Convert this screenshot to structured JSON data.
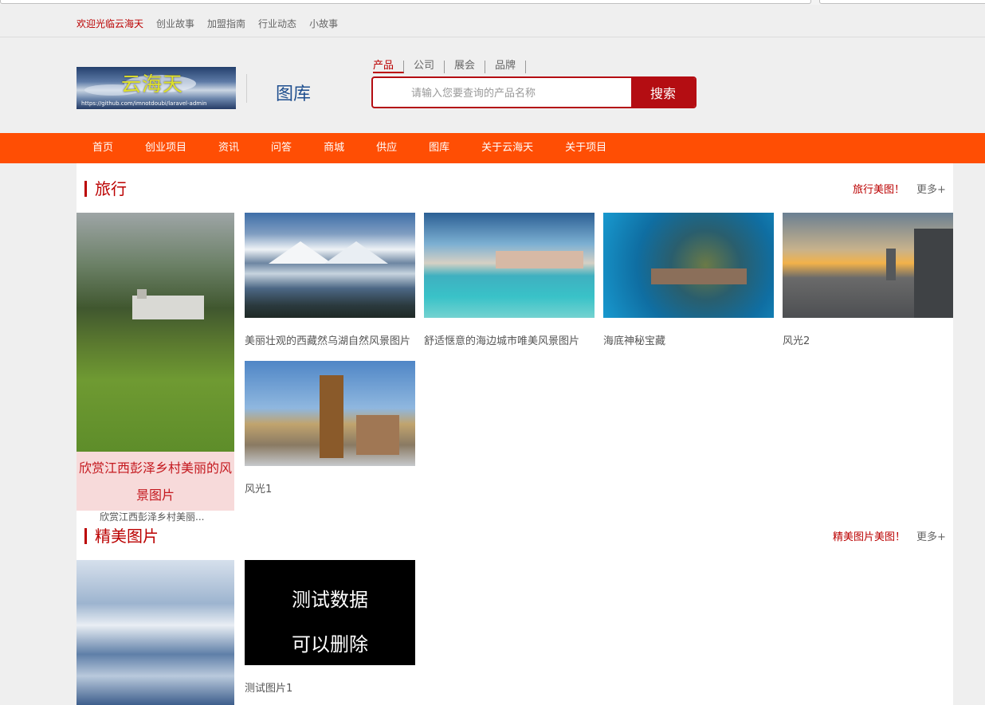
{
  "topbar": {
    "welcome": "欢迎光临云海天",
    "links": [
      "创业故事",
      "加盟指南",
      "行业动态",
      "小故事"
    ]
  },
  "header": {
    "logo_text": "云海天",
    "logo_url": "https://github.com/imnotdoubi/laravel-admin",
    "section_label": "图库"
  },
  "search": {
    "tabs": [
      "产品",
      "公司",
      "展会",
      "品牌"
    ],
    "placeholder": "请输入您要查询的产品名称",
    "button": "搜索"
  },
  "nav": {
    "items": [
      "首页",
      "创业项目",
      "资讯",
      "问答",
      "商城",
      "供应",
      "图库",
      "关于云海天",
      "关于项目"
    ]
  },
  "sections": {
    "travel": {
      "title": "旅行",
      "link": "旅行美图！",
      "more": "更多+",
      "feature_caption": "欣赏江西彭泽乡村美丽的风景图片",
      "feature_sub": "欣赏江西彭泽乡村美丽...",
      "items": [
        {
          "caption": "美丽壮观的西藏然乌湖自然风景图片"
        },
        {
          "caption": "舒适惬意的海边城市唯美风景图片"
        },
        {
          "caption": "海底神秘宝藏"
        },
        {
          "caption": "风光2"
        },
        {
          "caption": "风光1"
        }
      ]
    },
    "beauty": {
      "title": "精美图片",
      "link": "精美图片美图！",
      "more": "更多+",
      "items": [
        {
          "caption": "测试图片1",
          "image_text_1": "测试数据",
          "image_text_2": "可以删除"
        }
      ]
    }
  }
}
